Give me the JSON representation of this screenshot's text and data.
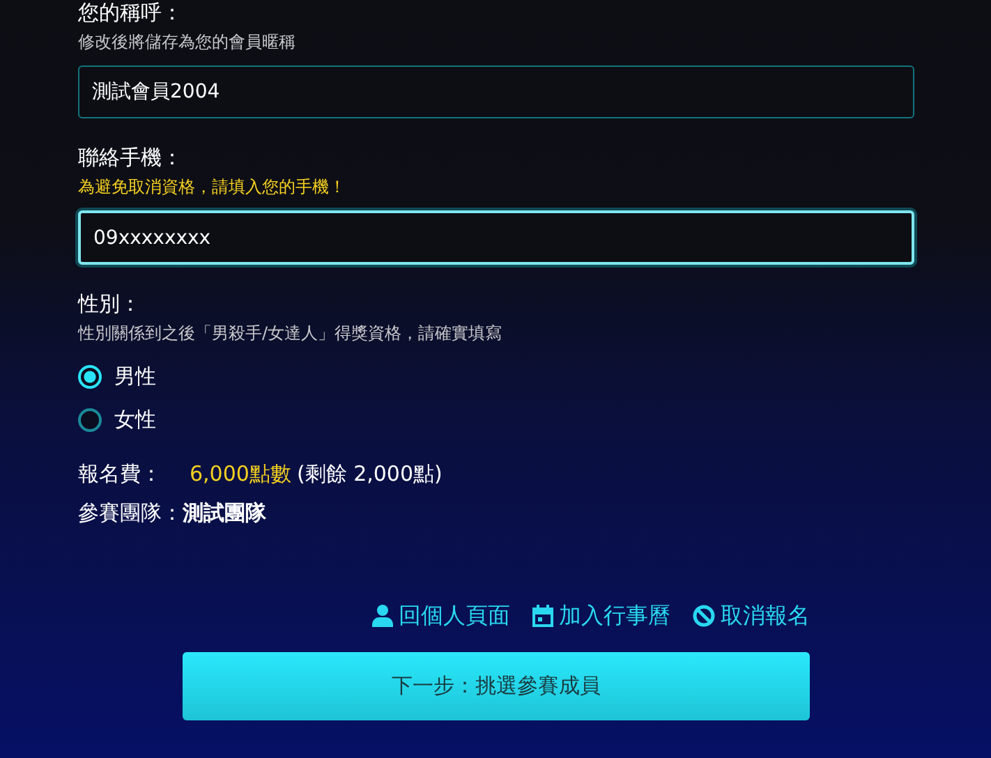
{
  "nickname": {
    "label": "您的稱呼：",
    "hint": "修改後將儲存為您的會員暱稱",
    "value": "測試會員2004",
    "focused": false
  },
  "phone": {
    "label": "聯絡手機：",
    "warning": "為避免取消資格，請填入您的手機！",
    "value": "09xxxxxxxx",
    "focused": true
  },
  "gender": {
    "label": "性別：",
    "hint": "性別關係到之後「男殺手/女達人」得獎資格，請確實填寫",
    "options": [
      {
        "label": "男性",
        "selected": true
      },
      {
        "label": "女性",
        "selected": false
      }
    ]
  },
  "fee": {
    "label": "報名費：",
    "amount": "6,000點數",
    "remaining": "(剩餘 2,000點)"
  },
  "team": {
    "label": "參賽團隊：",
    "value": "測試團隊"
  },
  "links": [
    {
      "kind": "user",
      "label": "回個人頁面"
    },
    {
      "kind": "calendar",
      "label": "加入行事曆"
    },
    {
      "kind": "cancel",
      "label": "取消報名"
    }
  ],
  "next_button": "下一步：挑選參賽成員"
}
